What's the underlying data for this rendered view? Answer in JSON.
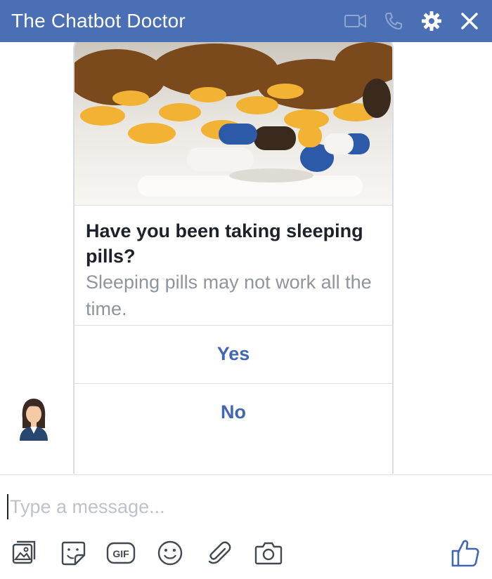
{
  "header": {
    "title": "The Chatbot Doctor",
    "icons": [
      "video-camera-icon",
      "phone-icon",
      "gear-icon",
      "close-icon"
    ],
    "background": "#4a6fb5"
  },
  "card": {
    "title": "Have you been taking sleeping pills?",
    "subtitle": "Sleeping pills may not work all the time.",
    "buttons": [
      {
        "label": "Yes"
      },
      {
        "label": "No"
      }
    ],
    "button_color": "#4267b2"
  },
  "composer": {
    "placeholder": "Type a message..."
  },
  "toolbar": {
    "gif_label": "GIF",
    "icons": [
      "photo-icon",
      "sticker-icon",
      "gif-icon",
      "emoji-icon",
      "paperclip-icon",
      "camera-icon",
      "thumbs-up-icon"
    ]
  }
}
